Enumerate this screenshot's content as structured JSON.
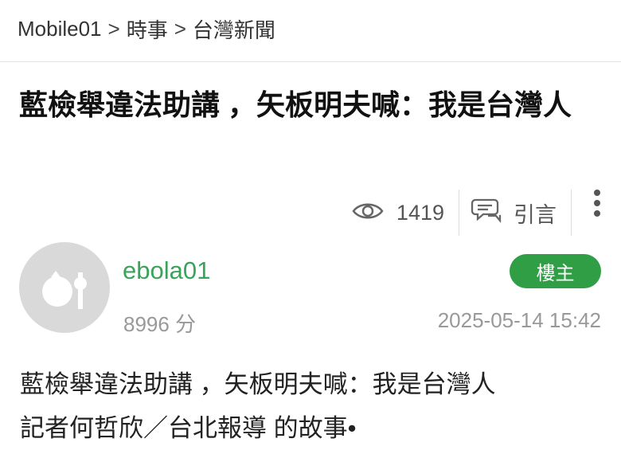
{
  "breadcrumb": {
    "items": [
      "Mobile01",
      "時事",
      "台灣新聞"
    ],
    "separator": ">"
  },
  "post": {
    "title": "藍檢舉違法助講 ，矢板明夫喊：我是台灣人",
    "views": "1419",
    "quote_label": "引言",
    "author": {
      "username": "ebola01",
      "score": "8996 分",
      "badge": "樓主"
    },
    "timestamp": "2025-05-14 15:42",
    "body": [
      "藍檢舉違法助講 ，矢板明夫喊：我是台灣人",
      "記者何哲欣／台北報導 的故事•"
    ]
  },
  "icons": {
    "views": "eye-icon",
    "quote": "quote-chat-icon",
    "more": "more-vertical-icon",
    "avatar": "default-avatar"
  },
  "colors": {
    "username": "#3aa35a",
    "badge_bg": "#2f9e44",
    "meta_text": "#999999"
  }
}
